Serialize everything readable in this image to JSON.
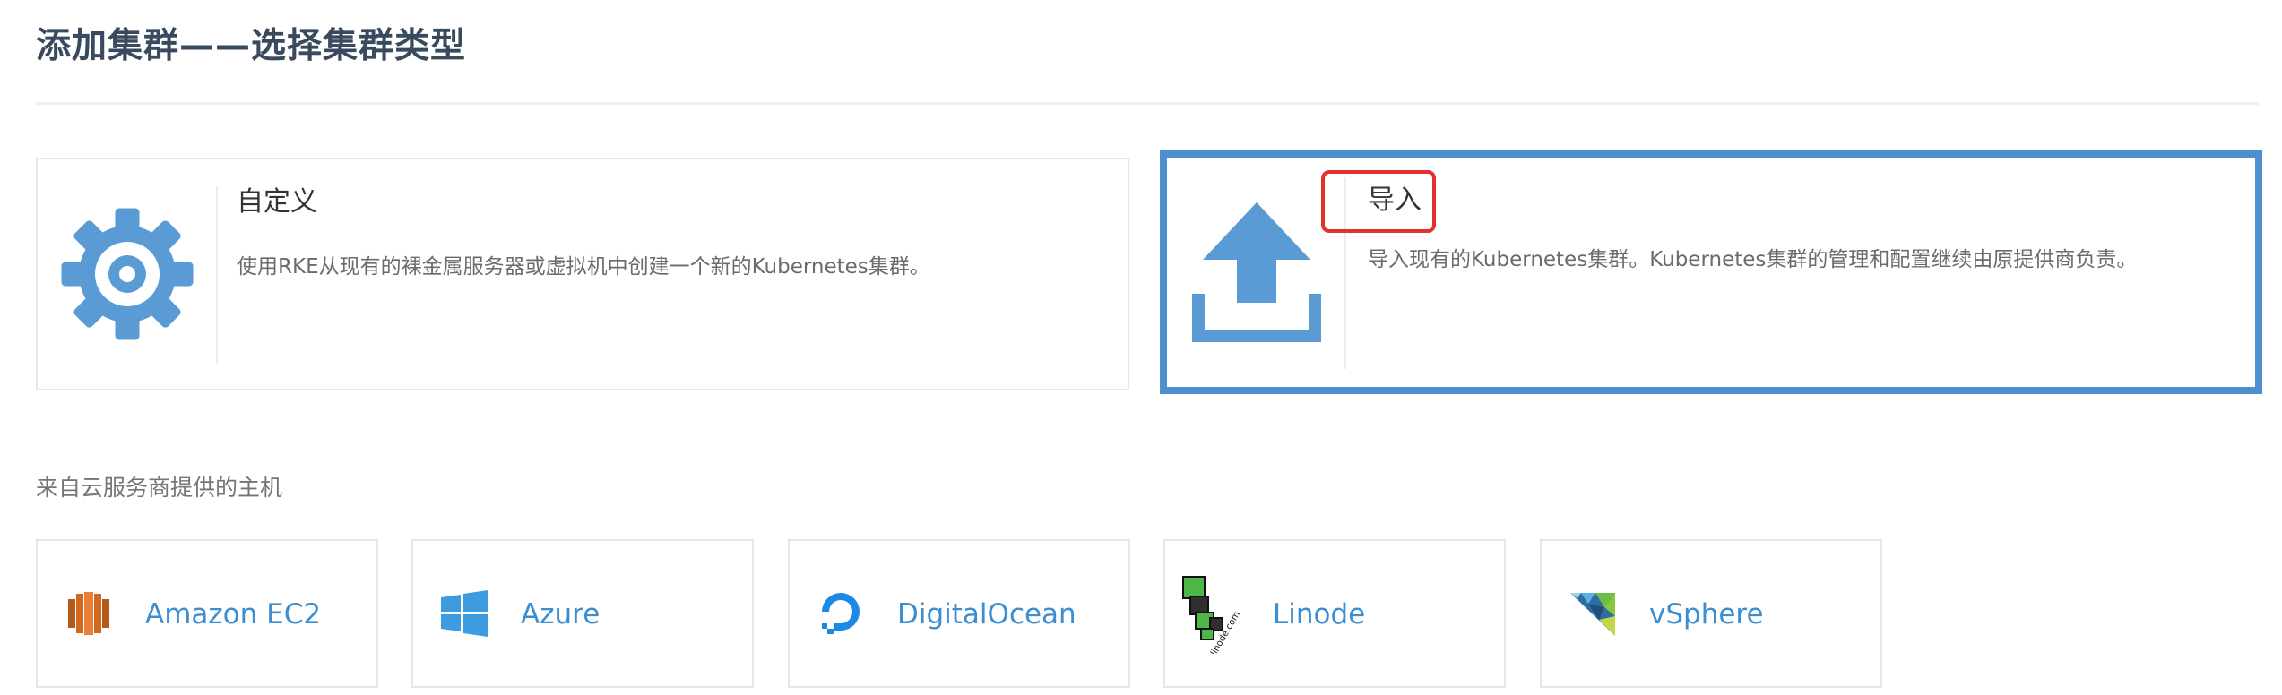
{
  "page": {
    "title": "添加集群——选择集群类型"
  },
  "cluster_types": [
    {
      "title": "自定义",
      "description": "使用RKE从现有的裸金属服务器或虚拟机中创建一个新的Kubernetes集群。",
      "icon": "gear-icon"
    },
    {
      "title": "导入",
      "description": "导入现有的Kubernetes集群。Kubernetes集群的管理和配置继续由原提供商负责。",
      "icon": "upload-icon"
    }
  ],
  "hosted": {
    "label": "来自云服务商提供的主机",
    "providers": [
      {
        "label": "Amazon EC2",
        "icon": "amazon-ec2-icon"
      },
      {
        "label": "Azure",
        "icon": "azure-icon"
      },
      {
        "label": "DigitalOcean",
        "icon": "digitalocean-icon"
      },
      {
        "label": "Linode",
        "icon": "linode-icon"
      },
      {
        "label": "vSphere",
        "icon": "vsphere-icon"
      }
    ]
  },
  "colors": {
    "accent": "#4d90cf",
    "highlight": "#e3322b",
    "icon_blue": "#5a9bd5",
    "link": "#3d8ed1"
  }
}
